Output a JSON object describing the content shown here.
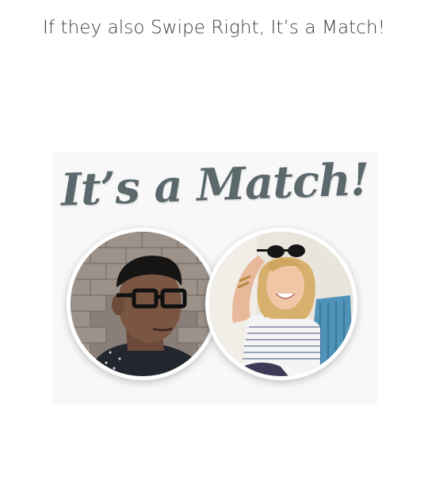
{
  "headline": "If they also Swipe Right, It’s a Match!",
  "match_card": {
    "title": "It’s a Match!",
    "left_photo": "man-with-glasses-photo",
    "right_photo": "woman-with-sunglasses-photo"
  }
}
